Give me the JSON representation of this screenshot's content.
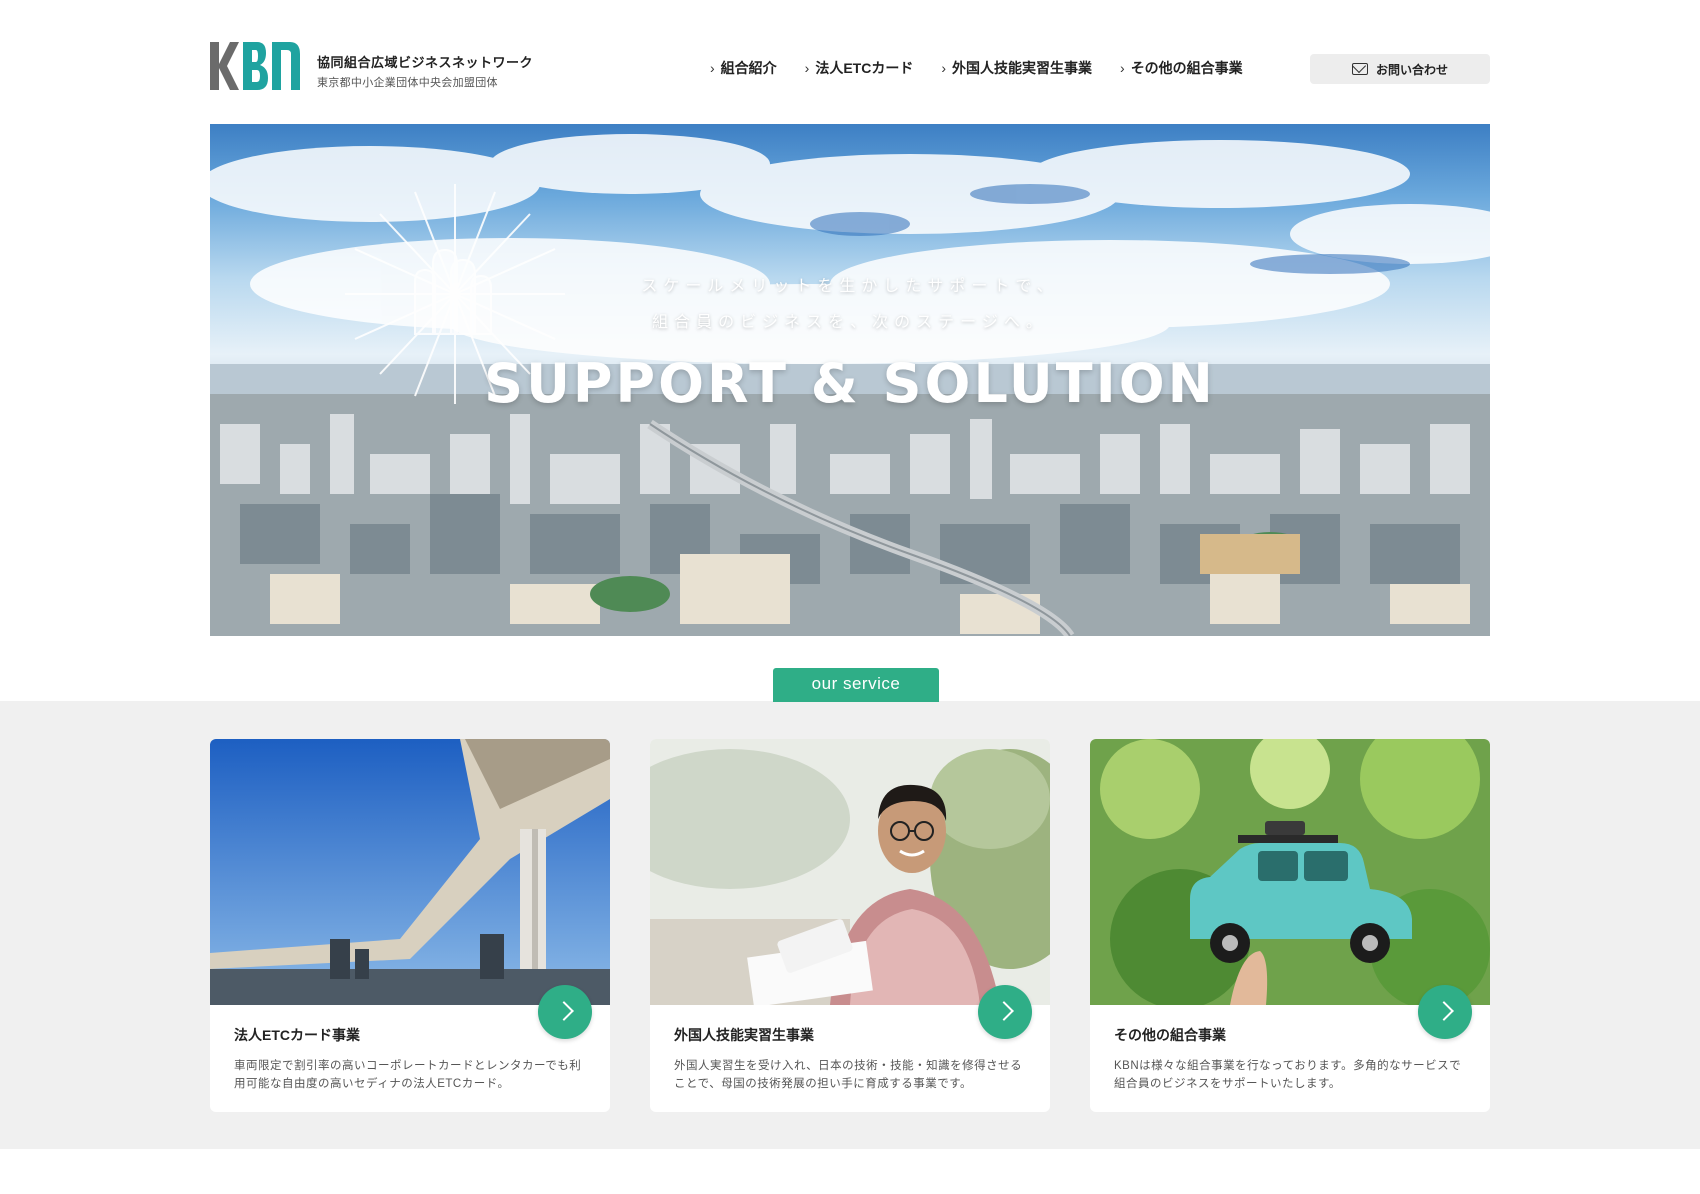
{
  "header": {
    "logo_text": "KBN",
    "brand_name": "協同組合広域ビジネスネットワーク",
    "brand_sub": "東京都中小企業団体中央会加盟団体",
    "nav": [
      {
        "label": "組合紹介"
      },
      {
        "label": "法人ETCカード"
      },
      {
        "label": "外国人技能実習生事業"
      },
      {
        "label": "その他の組合事業"
      }
    ],
    "contact_label": "お問い合わせ"
  },
  "hero": {
    "line1": "スケールメリットを生かしたサポートで、",
    "line2": "組合員のビジネスを、次のステージへ。",
    "title": "SUPPORT & SOLUTION"
  },
  "services": {
    "tab_label": "our service",
    "cards": [
      {
        "title": "法人ETCカード事業",
        "desc": "車両限定で割引率の高いコーポレートカードとレンタカーでも利用可能な自由度の高いセディナの法人ETCカード。"
      },
      {
        "title": "外国人技能実習生事業",
        "desc": "外国人実習生を受け入れ、日本の技術・技能・知識を修得させることで、母国の技術発展の担い手に育成する事業です。"
      },
      {
        "title": "その他の組合事業",
        "desc": "KBNは様々な組合事業を行なっております。多角的なサービスで組合員のビジネスをサポートいたします。"
      }
    ]
  },
  "colors": {
    "accent": "#2fae87",
    "logo_gray": "#6b6b6b",
    "logo_teal": "#1fa3a0"
  }
}
